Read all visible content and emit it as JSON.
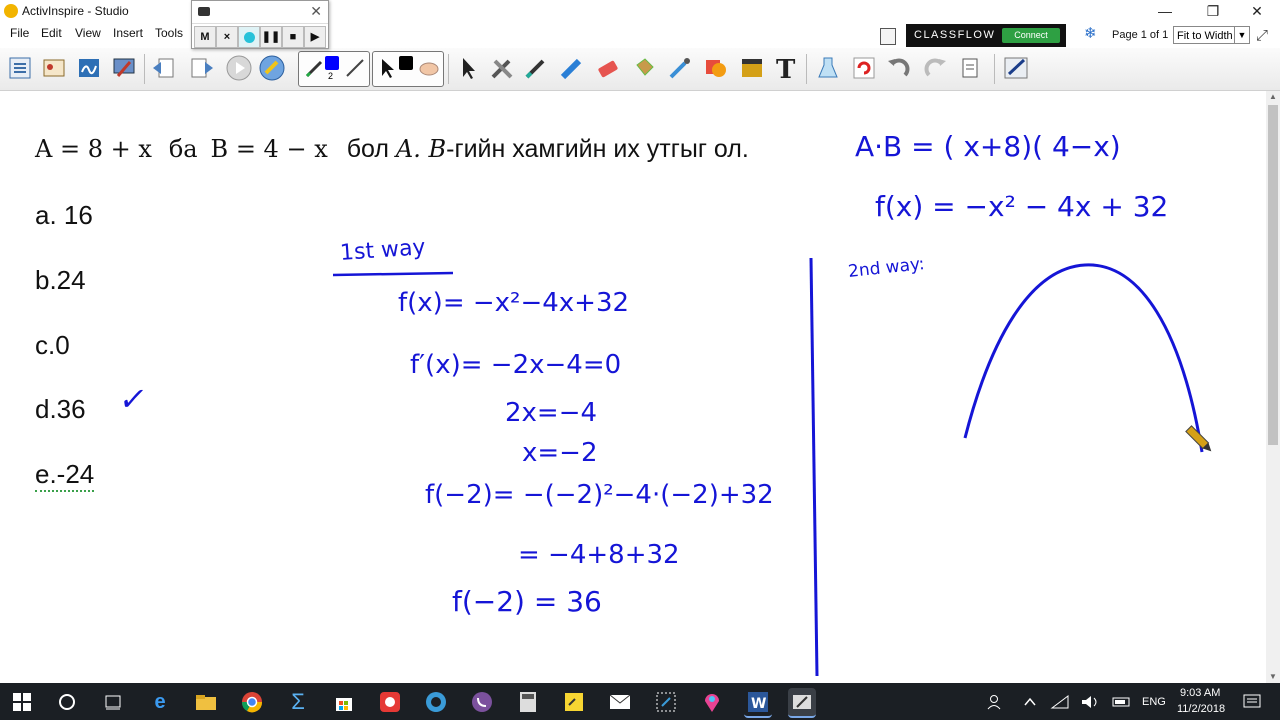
{
  "window": {
    "title": "ActivInspire - Studio",
    "minimize_glyph": "—",
    "restore_glyph": "❐",
    "close_glyph": "✕"
  },
  "menu": [
    "File",
    "Edit",
    "View",
    "Insert",
    "Tools"
  ],
  "recorder": {
    "buttons": [
      "M",
      "×",
      "",
      "❚❚",
      "■",
      "▶"
    ]
  },
  "classflow": {
    "name": "CLASSFLOW",
    "connect": "Connect"
  },
  "page": {
    "label": "Page 1 of 1",
    "fit": "Fit to Width"
  },
  "pen": {
    "width_label": "2",
    "color": "#0000ff"
  },
  "question": {
    "prefix": "A = 8 + x",
    "ba": "ба",
    "b_expr": "B = 4 − x",
    "bol": "бол",
    "ab": "A. B",
    "rest": "-гийн хамгийн их утгыг ол."
  },
  "options": [
    "a. 16",
    "b.24",
    "c.0",
    "d.36",
    "e.-24"
  ],
  "checkmark": "✓",
  "handwriting": {
    "way1_heading": "1st way",
    "way1_lines": [
      "f(x)= −x²−4x+32",
      "f′(x)= −2x−4=0",
      "2x=−4",
      "x=−2",
      "f(−2)= −(−2)²−4·(−2)+32",
      "=  −4+8+32",
      "f(−2) = 36"
    ],
    "ab_product": "A·B = ( x+8)( 4−x)",
    "fx": "f(x) = −x² − 4x + 32",
    "way2_heading": "2nd way:"
  },
  "tray": {
    "lang": "ENG",
    "time": "9:03 AM",
    "date": "11/2/2018"
  },
  "colors": {
    "ink": "#1515d6",
    "taskbar": "#1b1f24",
    "classflow_green": "#2ea043"
  }
}
